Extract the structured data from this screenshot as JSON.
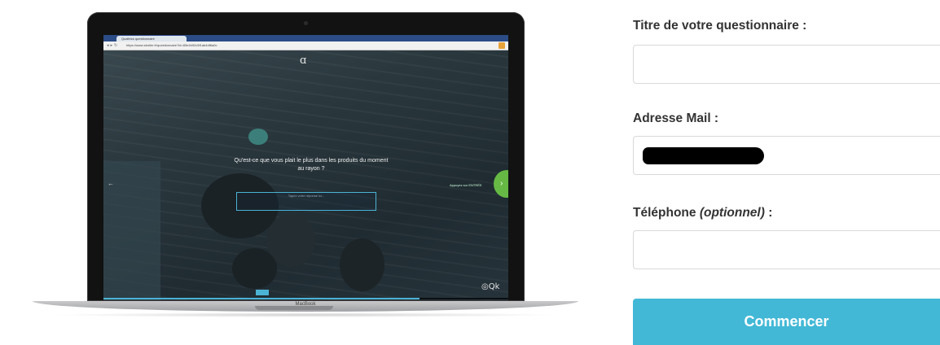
{
  "mockup": {
    "browser_tab_title": "Qualtrics questionnaire",
    "browser_url": "https://www.stroller.fr/questionnaire?id=83e4b92c5f1ab4df6a0c",
    "site_logo": "ɑ",
    "question": "Qu'est-ce que vous plait le plus dans les produits du moment au rayon ?",
    "answer_placeholder": "Tapez votre réponse ici...",
    "hint_text": "Appuyez sur ENTRÉE",
    "next_arrow": "›",
    "prev_arrow": "←",
    "progress_fraction": 0.78,
    "brand_mark": "◎Qk",
    "device_label": "MacBook"
  },
  "form": {
    "title_label": "Titre de votre questionnaire :",
    "title_value": "",
    "email_label": "Adresse Mail :",
    "email_value_redacted": true,
    "phone_label_main": "Téléphone ",
    "phone_label_optional": "(optionnel)",
    "phone_label_suffix": " :",
    "phone_value": "",
    "submit_label": "Commencer"
  },
  "colors": {
    "accent": "#42b8d6",
    "next_button": "#66b944",
    "label_text": "#333333"
  }
}
